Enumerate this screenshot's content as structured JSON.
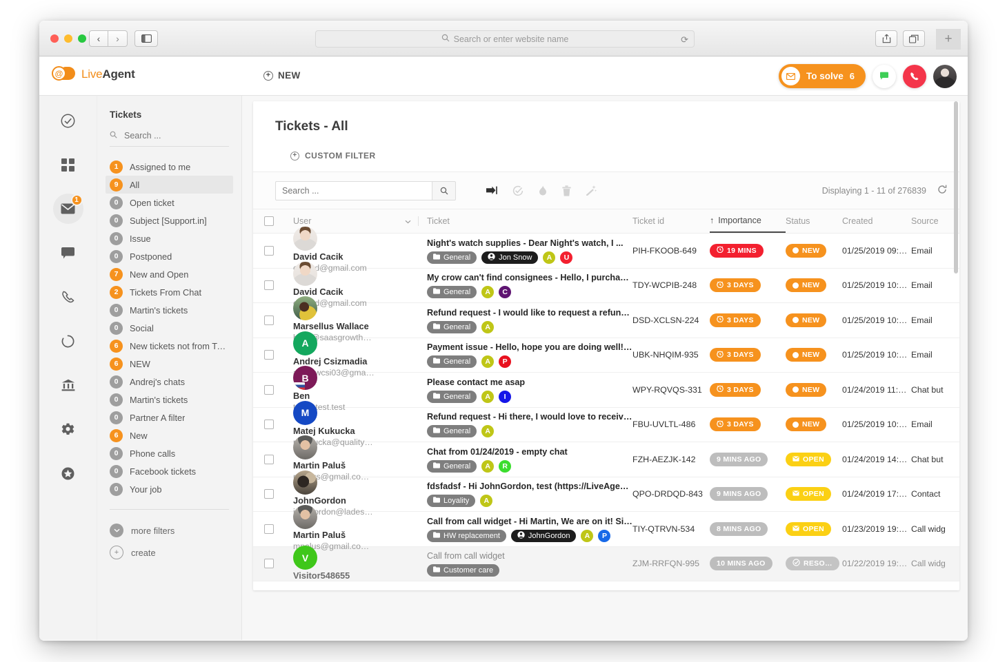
{
  "browser": {
    "address_placeholder": "Search or enter website name",
    "search_icon": "search-icon",
    "reload_icon": "reload-icon",
    "back_icon": "back-arrow-icon",
    "forward_icon": "forward-arrow-icon",
    "sidebar_icon": "sidebar-toggle-icon",
    "share_icon": "share-icon",
    "tabs_icon": "show-tabs-icon",
    "new_tab_icon": "plus-icon"
  },
  "app_header": {
    "logo_at": "@",
    "logo_text_light": "Live",
    "logo_text_bold": "Agent",
    "new_label": "NEW",
    "to_solve_label": "To solve",
    "to_solve_count": "6",
    "chat_icon": "chat-bubble-icon",
    "phone_icon": "phone-icon",
    "avatar": "user-avatar"
  },
  "rail": [
    {
      "icon": "check-circle-icon",
      "name": "rail-item-approvals",
      "badge": null,
      "active": false
    },
    {
      "icon": "dashboard-grid-icon",
      "name": "rail-item-dashboard",
      "badge": null,
      "active": false
    },
    {
      "icon": "envelope-icon",
      "name": "rail-item-tickets",
      "badge": "1",
      "active": true
    },
    {
      "icon": "chat-bubble-icon",
      "name": "rail-item-chats",
      "badge": null,
      "active": false
    },
    {
      "icon": "phone-icon",
      "name": "rail-item-calls",
      "badge": null,
      "active": false
    },
    {
      "icon": "circle-loader-icon",
      "name": "rail-item-activity",
      "badge": null,
      "active": false
    },
    {
      "icon": "bank-icon",
      "name": "rail-item-reports",
      "badge": null,
      "active": false
    },
    {
      "icon": "gear-icon",
      "name": "rail-item-settings",
      "badge": null,
      "active": false
    },
    {
      "icon": "star-circle-icon",
      "name": "rail-item-favorites",
      "badge": null,
      "active": false
    }
  ],
  "filters": {
    "title": "Tickets",
    "search_placeholder": "Search ...",
    "items": [
      {
        "count": "1",
        "label": "Assigned to me",
        "active": true,
        "selected": false
      },
      {
        "count": "9",
        "label": "All",
        "active": true,
        "selected": true
      },
      {
        "count": "0",
        "label": "Open ticket",
        "active": false,
        "selected": false
      },
      {
        "count": "0",
        "label": "Subject [Support.in]",
        "active": false,
        "selected": false
      },
      {
        "count": "0",
        "label": "Issue",
        "active": false,
        "selected": false
      },
      {
        "count": "0",
        "label": "Postponed",
        "active": false,
        "selected": false
      },
      {
        "count": "7",
        "label": "New and Open",
        "active": true,
        "selected": false
      },
      {
        "count": "2",
        "label": "Tickets From Chat",
        "active": true,
        "selected": false
      },
      {
        "count": "0",
        "label": "Martin's tickets",
        "active": false,
        "selected": false
      },
      {
        "count": "0",
        "label": "Social",
        "active": false,
        "selected": false
      },
      {
        "count": "6",
        "label": "New tickets not from Twi…",
        "active": true,
        "selected": false
      },
      {
        "count": "6",
        "label": "NEW",
        "active": true,
        "selected": false
      },
      {
        "count": "0",
        "label": "Andrej's chats",
        "active": false,
        "selected": false
      },
      {
        "count": "0",
        "label": "Martin's tickets",
        "active": false,
        "selected": false
      },
      {
        "count": "0",
        "label": "Partner A filter",
        "active": false,
        "selected": false
      },
      {
        "count": "6",
        "label": "New",
        "active": true,
        "selected": false
      },
      {
        "count": "0",
        "label": "Phone calls",
        "active": false,
        "selected": false
      },
      {
        "count": "0",
        "label": "Facebook tickets",
        "active": false,
        "selected": false
      },
      {
        "count": "0",
        "label": "Your job",
        "active": false,
        "selected": false
      }
    ],
    "more_filters_label": "more filters",
    "create_label": "create"
  },
  "main": {
    "title": "Tickets - All",
    "custom_filter_label": "CUSTOM FILTER",
    "search_placeholder": "Search ...",
    "toolbar_icons": [
      {
        "name": "forward-icon",
        "glyph": "➡",
        "dark": true
      },
      {
        "name": "resolve-check-icon",
        "glyph": "✓",
        "dark": false
      },
      {
        "name": "flame-icon",
        "glyph": "🔥",
        "dark": false
      },
      {
        "name": "trash-icon",
        "glyph": "🗑",
        "dark": false
      },
      {
        "name": "magic-wand-icon",
        "glyph": "✨",
        "dark": false
      }
    ],
    "displaying": "Displaying 1 - 11 of 276839",
    "refresh_icon": "refresh-icon",
    "columns": {
      "user": "User",
      "ticket": "Ticket",
      "ticket_id": "Ticket id",
      "importance": "Importance",
      "status": "Status",
      "created": "Created",
      "source": "Source"
    },
    "sort_indicator": "↑",
    "rows": [
      {
        "name": "David Cacik",
        "email": "cacik.d@gmail.com",
        "avatar_kind": "photo-david",
        "avatar_letter": "",
        "subject": "Night's watch supplies - Dear Night&#39;s watch, I ...",
        "dept": "General",
        "agent": "Jon Snow",
        "letter_tags": [
          {
            "letter": "A",
            "color": "#bfc617"
          },
          {
            "letter": "U",
            "color": "#f3202f"
          }
        ],
        "ticket_id": "PIH-FKOOB-649",
        "importance": "19 MINS",
        "importance_style": "red",
        "status": "NEW",
        "status_style": "orange",
        "status_icon": "dot",
        "created": "01/25/2019 09:…",
        "source": "Email",
        "dim": false
      },
      {
        "name": "David Cacik",
        "email": "cacik.d@gmail.com",
        "avatar_kind": "photo-david",
        "avatar_letter": "",
        "subject": "My crow can't find consignees - Hello, I purchased ...",
        "dept": "General",
        "agent": null,
        "letter_tags": [
          {
            "letter": "A",
            "color": "#bfc617"
          },
          {
            "letter": "C",
            "color": "#5e1471"
          }
        ],
        "ticket_id": "TDY-WCPIB-248",
        "importance": "3 DAYS",
        "importance_style": "orange",
        "status": "NEW",
        "status_style": "orange",
        "status_icon": "dot",
        "created": "01/25/2019 10:…",
        "source": "Email",
        "dim": false
      },
      {
        "name": "Marsellus Wallace",
        "email": "hello@saasgrowth…",
        "avatar_kind": "photo-marsellus",
        "avatar_letter": "",
        "subject": "Refund request - I would like to request a refund fo...",
        "dept": "General",
        "agent": null,
        "letter_tags": [
          {
            "letter": "A",
            "color": "#bfc617"
          }
        ],
        "ticket_id": "DSD-XCLSN-224",
        "importance": "3 DAYS",
        "importance_style": "orange",
        "status": "NEW",
        "status_style": "orange",
        "status_icon": "dot",
        "created": "01/25/2019 10:…",
        "source": "Email",
        "dim": false
      },
      {
        "name": "Andrej Csizmadia",
        "email": "andrewcsi03@gma…",
        "avatar_kind": "letter",
        "avatar_letter": "A",
        "avatar_color": "#14a85e",
        "subject": "Payment issue - Hello, hope you are doing well! Ca...",
        "dept": "General",
        "agent": null,
        "letter_tags": [
          {
            "letter": "A",
            "color": "#bfc617"
          },
          {
            "letter": "P",
            "color": "#e8111f"
          }
        ],
        "ticket_id": "UBK-NHQIM-935",
        "importance": "3 DAYS",
        "importance_style": "orange",
        "status": "NEW",
        "status_style": "orange",
        "status_icon": "dot",
        "created": "01/25/2019 10:…",
        "source": "Email",
        "dim": false
      },
      {
        "name": "Ben",
        "email": "test@test.test",
        "avatar_kind": "letter-flag",
        "avatar_letter": "B",
        "avatar_color": "#7d1a58",
        "subject": "Please contact me asap",
        "dept": "General",
        "agent": null,
        "letter_tags": [
          {
            "letter": "A",
            "color": "#bfc617"
          },
          {
            "letter": "I",
            "color": "#1516e8"
          }
        ],
        "ticket_id": "WPY-RQVQS-331",
        "importance": "3 DAYS",
        "importance_style": "orange",
        "status": "NEW",
        "status_style": "orange",
        "status_icon": "dot",
        "created": "01/24/2019 11:…",
        "source": "Chat but",
        "dim": false
      },
      {
        "name": "Matej Kukucka",
        "email": "mkukucka@quality…",
        "avatar_kind": "letter",
        "avatar_letter": "M",
        "avatar_color": "#1549c4",
        "subject": "Refund request - Hi there, I would love to receive a ...",
        "dept": "General",
        "agent": null,
        "letter_tags": [
          {
            "letter": "A",
            "color": "#bfc617"
          }
        ],
        "ticket_id": "FBU-UVLTL-486",
        "importance": "3 DAYS",
        "importance_style": "orange",
        "status": "NEW",
        "status_style": "orange",
        "status_icon": "dot",
        "created": "01/25/2019 10:…",
        "source": "Email",
        "dim": false
      },
      {
        "name": "Martin Paluš",
        "email": "mpalus@gmail.co…",
        "avatar_kind": "photo-martin",
        "avatar_letter": "",
        "subject": "Chat from 01/24/2019 - empty chat",
        "dept": "General",
        "agent": null,
        "letter_tags": [
          {
            "letter": "A",
            "color": "#bfc617"
          },
          {
            "letter": "R",
            "color": "#3bdd2e"
          }
        ],
        "ticket_id": "FZH-AEZJK-142",
        "importance": "9 MINS AGO",
        "importance_style": "grey",
        "status": "OPEN",
        "status_style": "yellow",
        "status_icon": "envelope",
        "created": "01/24/2019 14:…",
        "source": "Chat but",
        "dim": false
      },
      {
        "name": "JohnGordon",
        "email": "johngordon@lades…",
        "avatar_kind": "photo-john",
        "avatar_letter": "",
        "subject": "fdsfadsf - Hi JohnGordon, test (https://LiveAgentLi...",
        "dept": "Loyality",
        "agent": null,
        "letter_tags": [
          {
            "letter": "A",
            "color": "#bfc617"
          }
        ],
        "ticket_id": "QPO-DRDQD-843",
        "importance": "9 MINS AGO",
        "importance_style": "grey",
        "status": "OPEN",
        "status_style": "yellow",
        "status_icon": "envelope",
        "created": "01/24/2019 17:…",
        "source": "Contact",
        "dim": false
      },
      {
        "name": "Martin Paluš",
        "email": "mpalus@gmail.co…",
        "avatar_kind": "photo-martin",
        "avatar_letter": "",
        "subject": "Call from call widget - Hi Martin, We are on it! Sinc...",
        "dept": "HW replacement",
        "agent": "JohnGordon",
        "letter_tags": [
          {
            "letter": "A",
            "color": "#bfc617"
          },
          {
            "letter": "P",
            "color": "#1769e8"
          }
        ],
        "ticket_id": "TIY-QTRVN-534",
        "importance": "8 MINS AGO",
        "importance_style": "grey",
        "status": "OPEN",
        "status_style": "yellow",
        "status_icon": "envelope",
        "created": "01/23/2019 19:…",
        "source": "Call widg",
        "dim": false
      },
      {
        "name": "Visitor548655",
        "email": "",
        "avatar_kind": "letter",
        "avatar_letter": "V",
        "avatar_color": "#3fc71a",
        "subject": "Call from call widget",
        "dept": "Customer care",
        "agent": null,
        "letter_tags": [],
        "ticket_id": "ZJM-RRFQN-995",
        "importance": "10 MINS AGO",
        "importance_style": "grey",
        "status": "RESO…",
        "status_style": "greyst",
        "status_icon": "check",
        "created": "01/22/2019 19:…",
        "source": "Call widg",
        "dim": true
      }
    ]
  }
}
